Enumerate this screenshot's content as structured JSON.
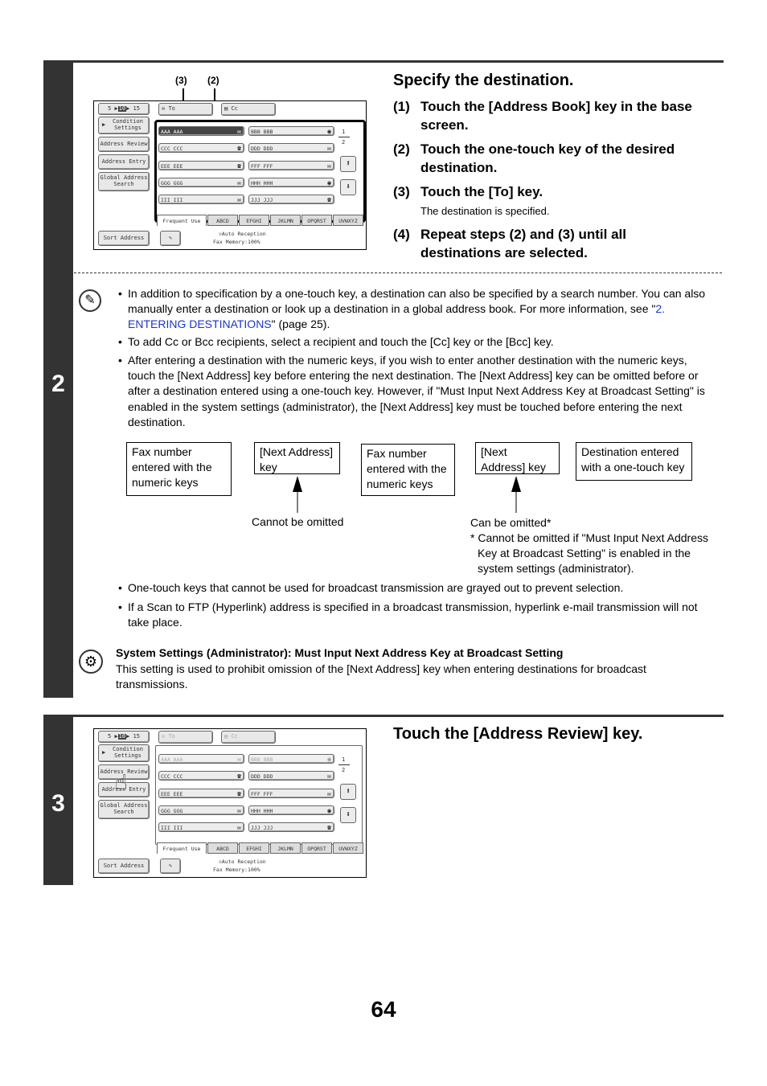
{
  "step2": {
    "number": "2",
    "title": "Specify the destination.",
    "substeps": [
      {
        "num": "(1)",
        "text": "Touch the [Address Book] key in the base screen."
      },
      {
        "num": "(2)",
        "text": "Touch the one-touch key of the desired destination."
      },
      {
        "num": "(3)",
        "text": "Touch the [To] key.",
        "note": "The destination is specified."
      },
      {
        "num": "(4)",
        "text": "Repeat steps (2) and (3) until all destinations are selected."
      }
    ],
    "callouts": {
      "c3": "(3)",
      "c2": "(2)"
    },
    "notes": {
      "bullet1_pre": "In addition to specification by a one-touch key, a destination can also be specified by a search number. You can also manually enter a destination or look up a destination in a global address book. For more information, see \"",
      "bullet1_link": "2. ENTERING DESTINATIONS",
      "bullet1_post": "\" (page 25).",
      "bullet2": "To add Cc or Bcc recipients, select a recipient and touch the [Cc] key or the [Bcc] key.",
      "bullet3": "After entering a destination with the numeric keys, if you wish to enter another destination with the numeric keys, touch the [Next Address] key before entering the next destination. The [Next Address] key can be omitted before or after a destination entered using a one-touch key. However, if \"Must Input Next Address Key at Broadcast Setting\" is enabled in the system settings (administrator), the [Next Address] key must be touched before entering the next destination.",
      "bullet4": "One-touch keys that cannot be used for broadcast transmission are grayed out to prevent selection.",
      "bullet5": "If a Scan to FTP (Hyperlink) address is specified in a broadcast transmission, hyperlink e-mail transmission will not take place."
    },
    "diagram": {
      "boxes": [
        "Fax number entered with the numeric keys",
        "[Next Address] key",
        "Fax number entered with the numeric keys",
        "[Next Address] key",
        "Destination entered with a one-touch key"
      ],
      "label_cannot": "Cannot be omitted",
      "label_can": "Can be omitted*",
      "footnote": "* Cannot be omitted if \"Must Input Next Address Key at Broadcast Setting\" is enabled in the system settings (administrator)."
    },
    "system_settings": {
      "title": "System Settings (Administrator): Must Input Next Address Key at Broadcast Setting",
      "text": "This setting is used to prohibit omission of the [Next Address] key when entering destinations for broadcast transmissions."
    }
  },
  "step3": {
    "number": "3",
    "title": "Touch the [Address Review] key."
  },
  "screen": {
    "display_count": {
      "a": "5",
      "b": "10",
      "c": "15"
    },
    "left_buttons": [
      "Condition Settings",
      "Address Review",
      "Address Entry",
      "Global Address Search"
    ],
    "sort_address": "Sort Address",
    "to_label": "To",
    "cc_label": "Cc",
    "keys": [
      {
        "name": "AAA AAA",
        "icon": "email"
      },
      {
        "name": "BBB BBB",
        "icon": "globe"
      },
      {
        "name": "CCC CCC",
        "icon": "phone"
      },
      {
        "name": "DDD DDD",
        "icon": "email"
      },
      {
        "name": "EEE EEE",
        "icon": "phone"
      },
      {
        "name": "FFF FFF",
        "icon": "email"
      },
      {
        "name": "GGG GGG",
        "icon": "email"
      },
      {
        "name": "HHH HHH",
        "icon": "globe"
      },
      {
        "name": "III III",
        "icon": "email"
      },
      {
        "name": "JJJ JJJ",
        "icon": "phone"
      }
    ],
    "page_current": "1",
    "page_total": "2",
    "tabs": [
      "Frequent Use",
      "ABCD",
      "EFGHI",
      "JKLMN",
      "OPQRST",
      "UVWXYZ"
    ],
    "status1": "Auto Reception",
    "status2": "Fax Memory:100%"
  },
  "page_number": "64"
}
